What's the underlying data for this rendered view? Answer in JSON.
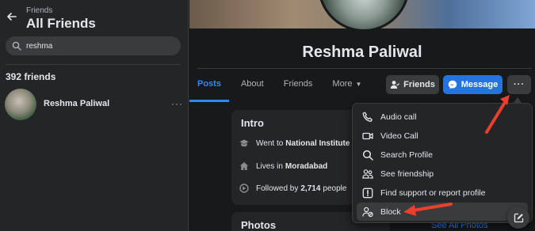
{
  "sidebar": {
    "breadcrumb": "Friends",
    "title": "All Friends",
    "search_value": "reshma",
    "friends_count": "392 friends",
    "friend": {
      "name": "Reshma Paliwal",
      "more": "···"
    }
  },
  "profile": {
    "name": "Reshma Paliwal",
    "tabs": [
      {
        "label": "Posts"
      },
      {
        "label": "About"
      },
      {
        "label": "Friends"
      },
      {
        "label": "More",
        "caret": "▼"
      }
    ],
    "buttons": {
      "friends": "Friends",
      "message": "Message",
      "more": "···"
    },
    "intro": {
      "title": "Intro",
      "education_prefix": "Went to",
      "education_place": "National Institute",
      "location_prefix": "Lives in",
      "location": "Moradabad",
      "followers_prefix": "Followed by",
      "followers_count": "2,714",
      "followers_suffix": "people"
    },
    "photos_title": "Photos",
    "see_all": "See All Photos"
  },
  "menu": {
    "items": [
      {
        "label": "Audio call",
        "icon": "phone-icon"
      },
      {
        "label": "Video Call",
        "icon": "video-icon"
      },
      {
        "label": "Search Profile",
        "icon": "search-icon"
      },
      {
        "label": "See friendship",
        "icon": "friendship-icon"
      },
      {
        "label": "Find support or report profile",
        "icon": "report-icon"
      },
      {
        "label": "Block",
        "icon": "block-user-icon"
      }
    ]
  },
  "colors": {
    "accent": "#2d88ff",
    "message_button": "#2374e1",
    "annotation_arrow": "#e8402c",
    "background": "#18191a",
    "surface": "#242526"
  }
}
